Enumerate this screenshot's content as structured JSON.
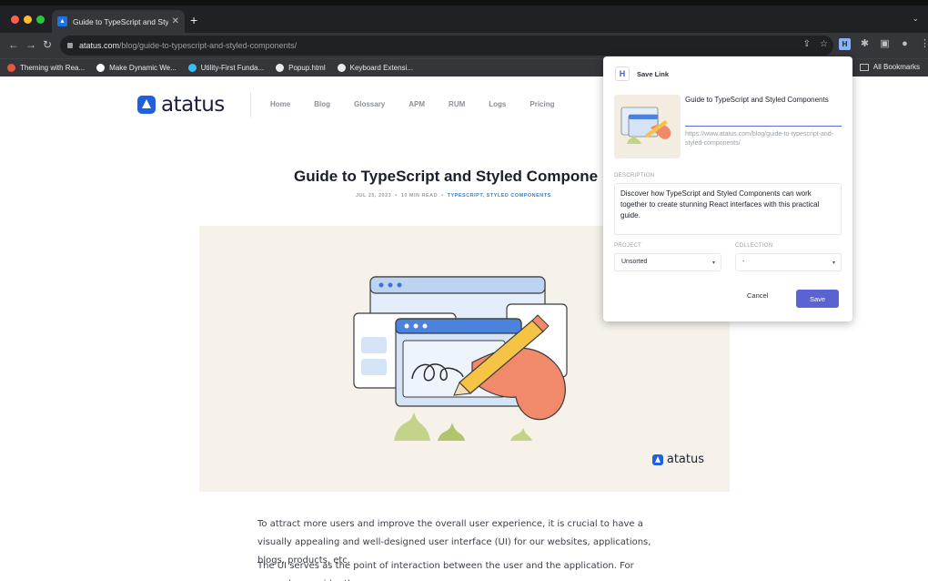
{
  "browser": {
    "tab_title": "Guide to TypeScript and Styled",
    "url_domain": "atatus.com",
    "url_path": "/blog/guide-to-typescript-and-styled-components/",
    "bookmarks": [
      {
        "label": "Theming with Rea...",
        "color": "#e8563b"
      },
      {
        "label": "Make Dynamic We...",
        "color": "#ffffff"
      },
      {
        "label": "Utility-First Funda...",
        "color": "#38bdf8"
      },
      {
        "label": "Popup.html",
        "color": "#e8eaed"
      },
      {
        "label": "Keyboard Extensi...",
        "color": "#e8eaed"
      }
    ],
    "all_bookmarks": "All Bookmarks"
  },
  "site": {
    "logo_text": "atatus",
    "nav": [
      "Home",
      "Blog",
      "Glossary",
      "APM",
      "RUM",
      "Logs",
      "Pricing"
    ]
  },
  "post": {
    "title": "Guide to TypeScript and Styled Compone",
    "date": "JUL 25, 2023",
    "read_time": "10 MIN READ",
    "tags": "TYPESCRIPT, STYLED COMPONENTS",
    "hero_logo": "atatus",
    "paragraph_1": "To attract more users and improve the overall user experience, it is crucial to have a visually appealing and well-designed user interface (UI) for our websites, applications, blogs, products, etc.",
    "paragraph_2": "The UI serves as the point of interaction between the user and the application. For example, consider the"
  },
  "popup": {
    "header": "Save Link",
    "logo_letter": "H",
    "link_title": "Guide to TypeScript and Styled Components",
    "link_url": "https://www.atatus.com/blog/guide-to-typescript-and-styled-components/",
    "description_label": "DESCRIPTION",
    "description": "Discover how TypeScript and Styled Components can work together to create stunning React interfaces with this practical guide.",
    "project_label": "PROJECT",
    "project_value": "Unsorted",
    "collection_label": "COLLECTION",
    "collection_value": "-",
    "cancel_label": "Cancel",
    "save_label": "Save"
  },
  "colors": {
    "accent": "#5b63d3",
    "brand": "#1f5fe0"
  }
}
